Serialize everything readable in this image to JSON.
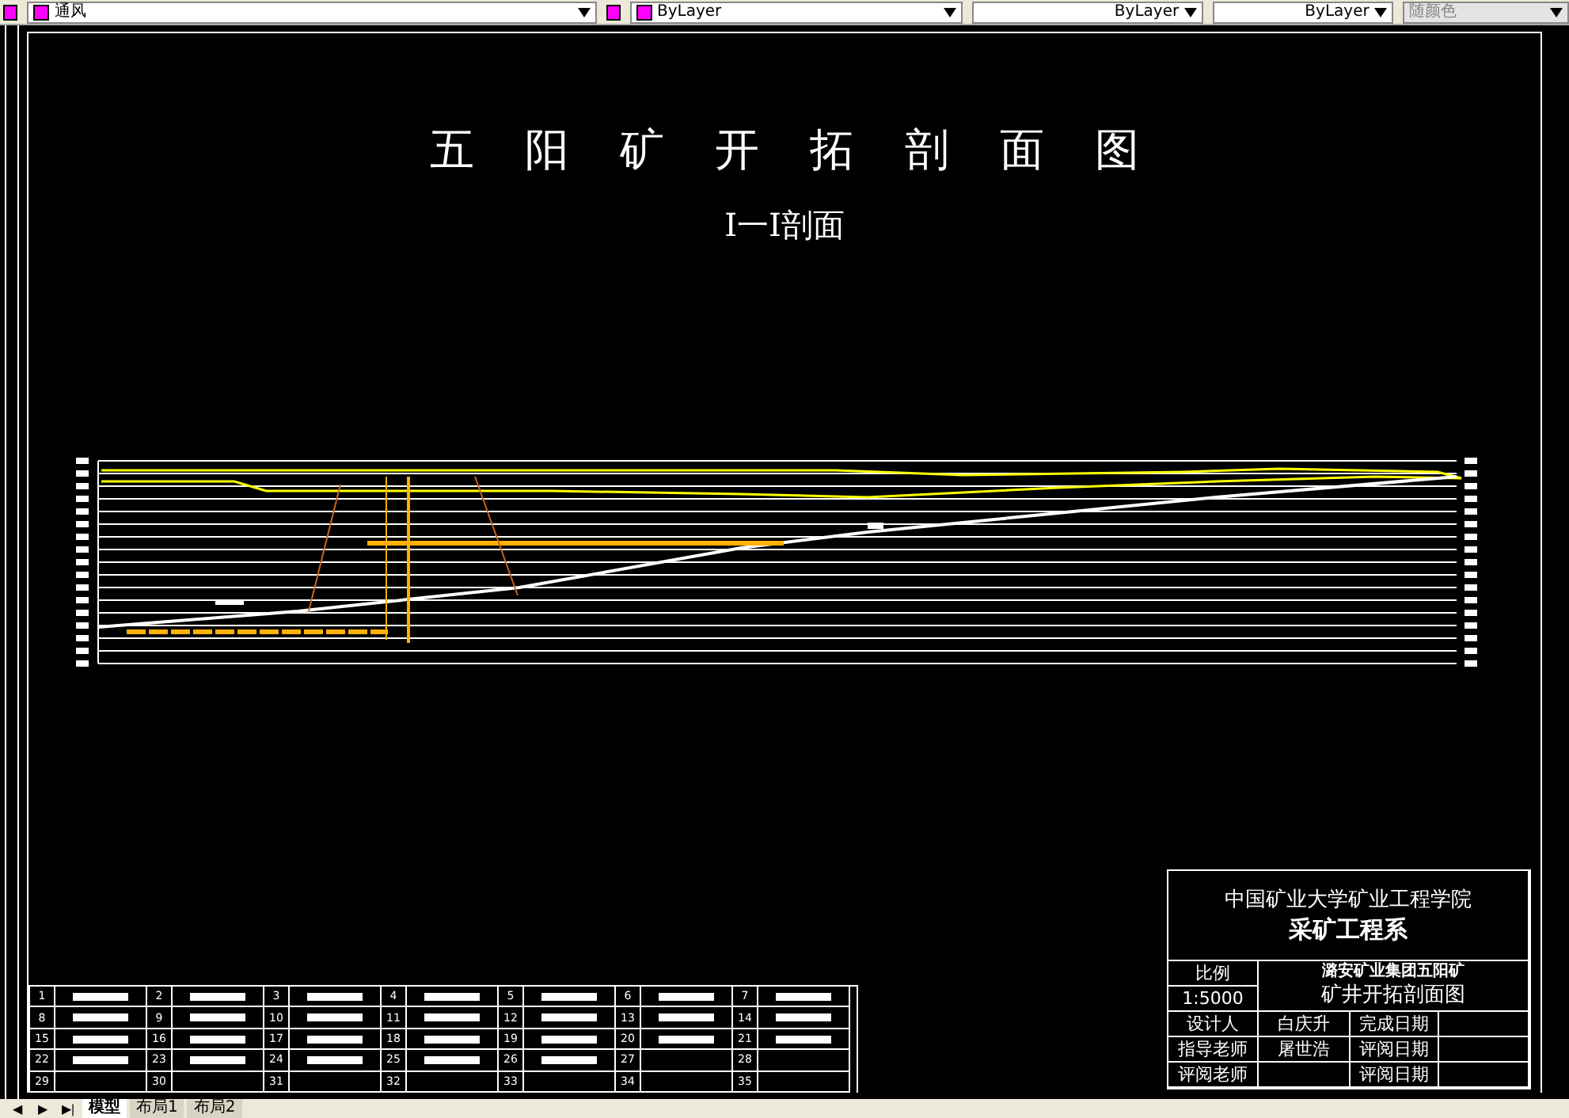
{
  "toolbar": {
    "layer": {
      "value": "通风"
    },
    "color_control": {
      "value": "ByLayer"
    },
    "linetype_control": {
      "value": "ByLayer"
    },
    "lineweight_control": {
      "value": "ByLayer"
    },
    "plot_style_control": {
      "value": "随颜色",
      "disabled": true
    }
  },
  "drawing": {
    "title": "五阳矿开拓剖面图",
    "subtitle": "I一I剖面"
  },
  "legend": {
    "items": [
      {
        "number": "1",
        "kind": "swatch"
      },
      {
        "number": "2",
        "kind": "swatch"
      },
      {
        "number": "3",
        "kind": "swatch"
      },
      {
        "number": "4",
        "kind": "swatch"
      },
      {
        "number": "5",
        "kind": "swatch"
      },
      {
        "number": "6",
        "kind": "swatch"
      },
      {
        "number": "7",
        "kind": "swatch"
      },
      {
        "number": "8",
        "kind": "swatch"
      },
      {
        "number": "9",
        "kind": "swatch"
      },
      {
        "number": "10",
        "kind": "swatch"
      },
      {
        "number": "11",
        "kind": "swatch"
      },
      {
        "number": "12",
        "kind": "swatch"
      },
      {
        "number": "13",
        "kind": "swatch"
      },
      {
        "number": "14",
        "kind": "swatch"
      },
      {
        "number": "15",
        "kind": "swatch"
      },
      {
        "number": "16",
        "kind": "swatch"
      },
      {
        "number": "17",
        "kind": "swatch"
      },
      {
        "number": "18",
        "kind": "swatch"
      },
      {
        "number": "19",
        "kind": "swatch"
      },
      {
        "number": "20",
        "kind": "swatch"
      },
      {
        "number": "21",
        "kind": "swatch"
      },
      {
        "number": "22",
        "kind": "swatch"
      },
      {
        "number": "23",
        "kind": "swatch"
      },
      {
        "number": "24",
        "kind": "swatch"
      },
      {
        "number": "25",
        "kind": "swatch"
      },
      {
        "number": "26",
        "kind": "swatch"
      },
      {
        "number": "27",
        "kind": "empty"
      },
      {
        "number": "28",
        "kind": "empty"
      },
      {
        "number": "29",
        "kind": "empty"
      },
      {
        "number": "30",
        "kind": "empty"
      },
      {
        "number": "31",
        "kind": "empty"
      },
      {
        "number": "32",
        "kind": "empty"
      },
      {
        "number": "33",
        "kind": "empty"
      },
      {
        "number": "34",
        "kind": "empty"
      },
      {
        "number": "35",
        "kind": "empty"
      }
    ]
  },
  "title_block": {
    "school": "中国矿业大学矿业工程学院",
    "department": "采矿工程系",
    "scale_label": "比例",
    "scale": "1:5000",
    "company": "潞安矿业集团五阳矿",
    "drawing_name": "矿井开拓剖面图",
    "rows": [
      {
        "role": "设计人",
        "name": "白庆升",
        "date_label": "完成日期"
      },
      {
        "role": "指导老师",
        "name": "屠世浩",
        "date_label": "评阅日期"
      },
      {
        "role": "评阅老师",
        "date_label": "评阅日期"
      }
    ]
  },
  "nav_buttons": [
    "◀",
    "▶",
    "▶|"
  ],
  "layout_tabs": [
    {
      "label": "模型",
      "selected": true
    },
    {
      "label": "布局1",
      "selected": false
    },
    {
      "label": "布局2",
      "selected": false
    }
  ]
}
